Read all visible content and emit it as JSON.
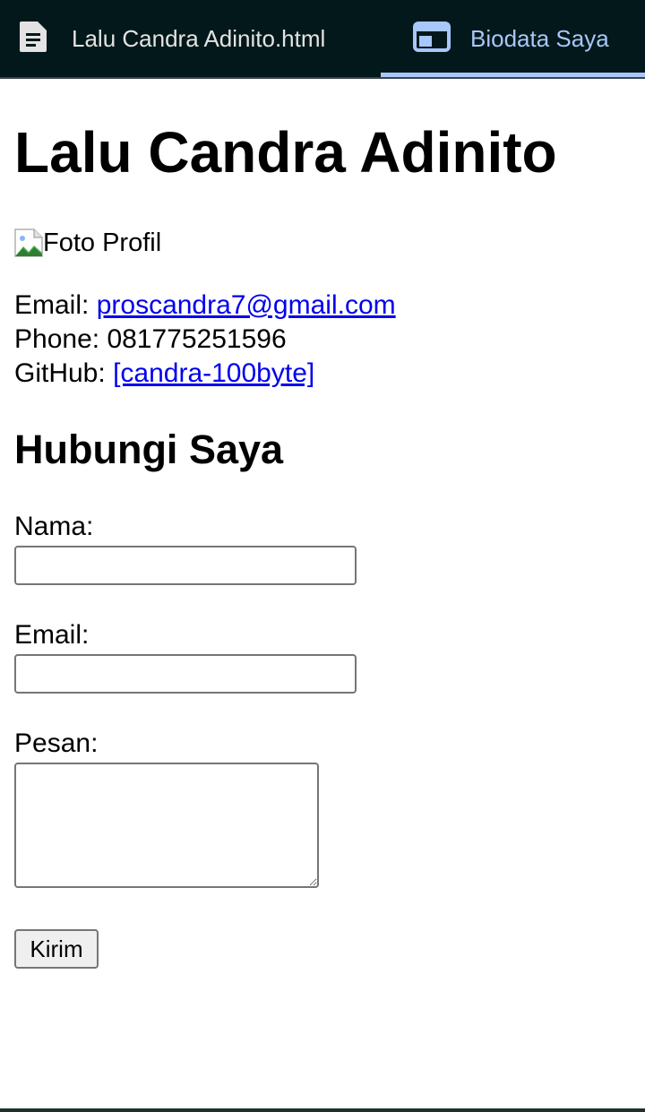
{
  "tabs": {
    "file": {
      "label": "Lalu Candra Adinito.html",
      "icon": "document-icon"
    },
    "page": {
      "label": "Biodata Saya",
      "icon": "web-page-icon",
      "active": true
    }
  },
  "profile": {
    "name": "Lalu Candra Adinito",
    "photo_alt": "Foto Profil",
    "email_label": "Email:",
    "email_value": "proscandra7@gmail.com",
    "phone_label": "Phone:",
    "phone_value": "081775251596",
    "github_label": "GitHub:",
    "github_value": "[candra-100byte]"
  },
  "contact": {
    "heading": "Hubungi Saya",
    "name_label": "Nama:",
    "name_value": "",
    "email_label": "Email:",
    "email_value": "",
    "message_label": "Pesan:",
    "message_value": "",
    "submit_label": "Kirim"
  },
  "colors": {
    "tabbar_bg": "#03181a",
    "active_tab_accent": "#a8c7fa",
    "link": "#0000ee"
  }
}
